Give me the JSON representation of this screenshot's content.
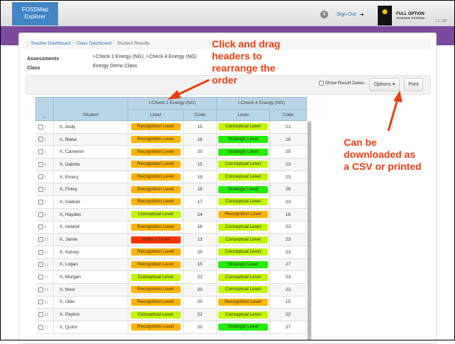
{
  "app": {
    "title_line1": "FOSSMap",
    "title_line2": "Explorer",
    "sign_out": "Sign Out",
    "version": "1.1.145",
    "brand_line1": "FULL OPTION",
    "brand_line2": "SCIENCE SYSTEM",
    "brand_logo": "FOSS"
  },
  "breadcrumb": [
    "Teacher Dashboard",
    "Class Dashboard",
    "Student Results"
  ],
  "info": {
    "assessments_label": "Assessments",
    "assessments_value": "I-Check 1 Energy (NG), I-Check 4 Energy (NG)",
    "class_label": "Class",
    "class_value": "Energy Demo Class"
  },
  "toolbar": {
    "show_dates": "Show Result Dates",
    "options": "Options ▾",
    "print": "Print"
  },
  "table": {
    "headers": {
      "num": "#",
      "student": "Student",
      "group1": "I-Check 1 Energy (NG)",
      "group2": "I-Check 4 Energy (NG)",
      "level": "Level",
      "code": "Code"
    },
    "level_colors": {
      "Recognition Level": "#ffb400",
      "Conceptual Level": "#c3f500",
      "Strategic Level": "#22ee00",
      "Notions Level": "#ff3300"
    },
    "rows": [
      {
        "n": "1",
        "name": "X, Andy",
        "l1": "Recognition Level",
        "c1": "15",
        "l2": "Conceptual Level",
        "c2": "23"
      },
      {
        "n": "2",
        "name": "X, Blake",
        "l1": "Recognition Level",
        "c1": "16",
        "l2": "Strategic Level",
        "c2": "26"
      },
      {
        "n": "3",
        "name": "X, Cameron",
        "l1": "Recognition Level",
        "c1": "20",
        "l2": "Strategic Level",
        "c2": "25"
      },
      {
        "n": "4",
        "name": "X, Dakota",
        "l1": "Recognition Level",
        "c1": "15",
        "l2": "Conceptual Level",
        "c2": "23"
      },
      {
        "n": "5",
        "name": "X, Emery",
        "l1": "Recognition Level",
        "c1": "19",
        "l2": "Conceptual Level",
        "c2": "23"
      },
      {
        "n": "6",
        "name": "X, Finley",
        "l1": "Recognition Level",
        "c1": "18",
        "l2": "Strategic Level",
        "c2": "26"
      },
      {
        "n": "7",
        "name": "X, Gabriel",
        "l1": "Recognition Level",
        "c1": "17",
        "l2": "Conceptual Level",
        "c2": "23"
      },
      {
        "n": "8",
        "name": "X, Hayden",
        "l1": "Conceptual Level",
        "c1": "24",
        "l2": "Recognition Level",
        "c2": "18"
      },
      {
        "n": "9",
        "name": "X, Ireland",
        "l1": "Recognition Level",
        "c1": "16",
        "l2": "Conceptual Level",
        "c2": "23"
      },
      {
        "n": "10",
        "name": "X, Jamie",
        "l1": "Notions Level",
        "c1": "13",
        "l2": "Conceptual Level",
        "c2": "23"
      },
      {
        "n": "11",
        "name": "X, Kelsey",
        "l1": "Recognition Level",
        "c1": "20",
        "l2": "Conceptual Level",
        "c2": "23"
      },
      {
        "n": "12",
        "name": "X, Logan",
        "l1": "Recognition Level",
        "c1": "15",
        "l2": "Strategic Level",
        "c2": "27"
      },
      {
        "n": "13",
        "name": "X, Morgan",
        "l1": "Conceptual Level",
        "c1": "22",
        "l2": "Conceptual Level",
        "c2": "23"
      },
      {
        "n": "14",
        "name": "X, Noor",
        "l1": "Recognition Level",
        "c1": "20",
        "l2": "Conceptual Level",
        "c2": "22"
      },
      {
        "n": "15",
        "name": "X, Ollie",
        "l1": "Recognition Level",
        "c1": "20",
        "l2": "Recognition Level",
        "c2": "15"
      },
      {
        "n": "16",
        "name": "X, Peyton",
        "l1": "Conceptual Level",
        "c1": "22",
        "l2": "Conceptual Level",
        "c2": "22"
      },
      {
        "n": "17",
        "name": "X, Quinn",
        "l1": "Recognition Level",
        "c1": "20",
        "l2": "Strategic Level",
        "c2": "27"
      }
    ]
  },
  "annotations": {
    "drag": "Click and drag headers to rearrange the order",
    "download": "Can be downloaded as a CSV or printed",
    "color": "#f03c0c"
  }
}
